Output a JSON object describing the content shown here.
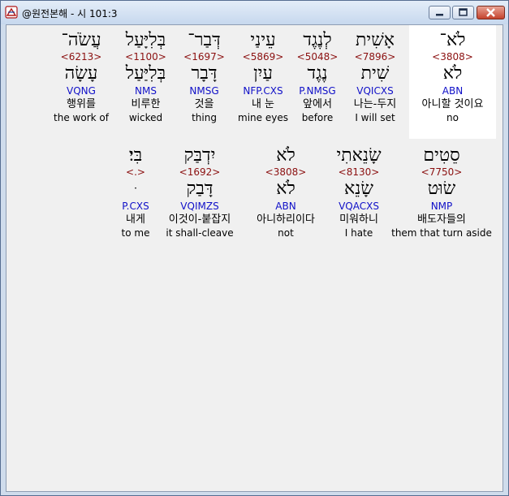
{
  "window": {
    "title": "@원전본해 - 시 101:3",
    "minimize_glyph": "▁",
    "maximize_glyph": "□",
    "close_glyph": "✕"
  },
  "words": [
    {
      "heb": "לֹא־",
      "strong": "<3808>",
      "root": "לֹא",
      "parse": "ABN",
      "kor": "아니할 것이요",
      "eng": "no"
    },
    {
      "heb": "אָשִׁית",
      "strong": "<7896>",
      "root": "שִׁית",
      "parse": "VQICXS",
      "kor": "나는-두지",
      "eng": "I will set"
    },
    {
      "heb": "לְנֶגֶד",
      "strong": "<5048>",
      "root": "נֶגֶד",
      "parse": "P.NMSG",
      "kor": "앞에서",
      "eng": "before"
    },
    {
      "heb": "עֵינַי",
      "strong": "<5869>",
      "root": "עַיִן",
      "parse": "NFP.CXS",
      "kor": "내 눈",
      "eng": "mine eyes"
    },
    {
      "heb": "דְּבַר־",
      "strong": "<1697>",
      "root": "דָּבָר",
      "parse": "NMSG",
      "kor": "것을",
      "eng": "thing"
    },
    {
      "heb": "בְּלִיָּעַל",
      "strong": "<1100>",
      "root": "בְּלִיַּעַל",
      "parse": "NMS",
      "kor": "비루한",
      "eng": "wicked"
    },
    {
      "heb": "עֲשֹׂה־",
      "strong": "<6213>",
      "root": "עָשָׂה",
      "parse": "VQNG",
      "kor": "행위를",
      "eng": "the work of"
    },
    {
      "heb": "סֵטִים",
      "strong": "<7750>",
      "root": "שׂוּט",
      "parse": "NMP",
      "kor": "배도자들의",
      "eng": "them that turn aside"
    },
    {
      "heb": "שָׂנֵאתִי",
      "strong": "<8130>",
      "root": "שָׂנֵא",
      "parse": "VQACXS",
      "kor": "미워하니",
      "eng": "I hate"
    },
    {
      "heb": "לֹא",
      "strong": "<3808>",
      "root": "לֹא",
      "parse": "ABN",
      "kor": "아니하리이다",
      "eng": "not"
    },
    {
      "heb": "יִדְבַּק",
      "strong": "<1692>",
      "root": "דָּבַק",
      "parse": "VQIMZS",
      "kor": "이것이-붙잡지",
      "eng": "it shall-cleave"
    },
    {
      "heb": "בִּי׃",
      "strong": "<.>",
      "root": "ּ",
      "parse": "P.CXS",
      "kor": "내게",
      "eng": "to me"
    }
  ]
}
